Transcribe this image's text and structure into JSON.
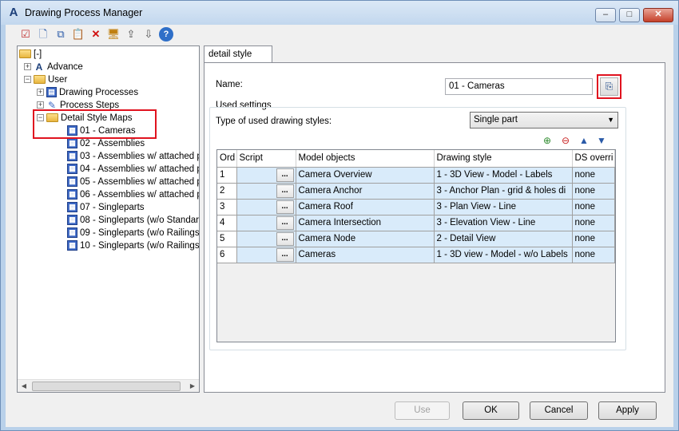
{
  "window": {
    "title": "Drawing Process Manager",
    "app_icon": "A",
    "controls": {
      "minimize": "–",
      "maximize": "□",
      "close": "✕"
    }
  },
  "toolbar": {
    "buttons": [
      {
        "name": "check-icon",
        "glyph": "☑"
      },
      {
        "name": "new-icon",
        "glyph": "🗋"
      },
      {
        "name": "copy-icon",
        "glyph": "⧉"
      },
      {
        "name": "paste-icon",
        "glyph": "📋"
      },
      {
        "name": "delete-icon",
        "glyph": "✕"
      },
      {
        "name": "monitor-icon",
        "glyph": "🖥"
      },
      {
        "name": "export-icon",
        "glyph": "⇪"
      },
      {
        "name": "import-icon",
        "glyph": "⇩"
      },
      {
        "name": "help-icon",
        "glyph": "?"
      }
    ]
  },
  "tree": {
    "root": "[-]",
    "advance": "Advance",
    "user": "User",
    "drawing_processes": "Drawing Processes",
    "process_steps": "Process Steps",
    "detail_style_maps": "Detail Style Maps",
    "children": [
      "01 - Cameras",
      "02 - Assemblies",
      "03 - Assemblies w/ attached p",
      "04 - Assemblies w/ attached p",
      "05 - Assemblies w/ attached p",
      "06 - Assemblies w/ attached p",
      "07 - Singleparts",
      "08 - Singleparts (w/o Standarc",
      "09 - Singleparts (w/o Railings,",
      "10 - Singleparts (w/o Railings,"
    ]
  },
  "tab": {
    "label": "detail style map"
  },
  "form": {
    "name_label": "Name:",
    "name_value": "01 - Cameras",
    "used_settings_label": "Used settings",
    "type_label": "Type of used drawing styles:",
    "type_value": "Single part"
  },
  "grid": {
    "columns": [
      "Ord",
      "Script",
      "Model objects",
      "Drawing style",
      "DS overri"
    ],
    "dots_label": "...",
    "rows": [
      {
        "ord": "1",
        "model": "Camera Overview",
        "style": "1 - 3D View - Model - Labels",
        "ds": "none"
      },
      {
        "ord": "2",
        "model": "Camera Anchor",
        "style": "3 - Anchor Plan - grid & holes di",
        "ds": "none"
      },
      {
        "ord": "3",
        "model": "Camera Roof",
        "style": "3 - Plan View - Line",
        "ds": "none"
      },
      {
        "ord": "4",
        "model": "Camera Intersection",
        "style": "3 - Elevation View - Line",
        "ds": "none"
      },
      {
        "ord": "5",
        "model": "Camera Node",
        "style": "2 - Detail View",
        "ds": "none"
      },
      {
        "ord": "6",
        "model": "Cameras",
        "style": "1 - 3D view - Model - w/o Labels",
        "ds": "none"
      }
    ]
  },
  "buttons": {
    "use": "Use",
    "ok": "OK",
    "cancel": "Cancel",
    "apply": "Apply"
  },
  "colors": {
    "highlight_box": "#e0131f",
    "row_fill": "#d9ebfa"
  }
}
